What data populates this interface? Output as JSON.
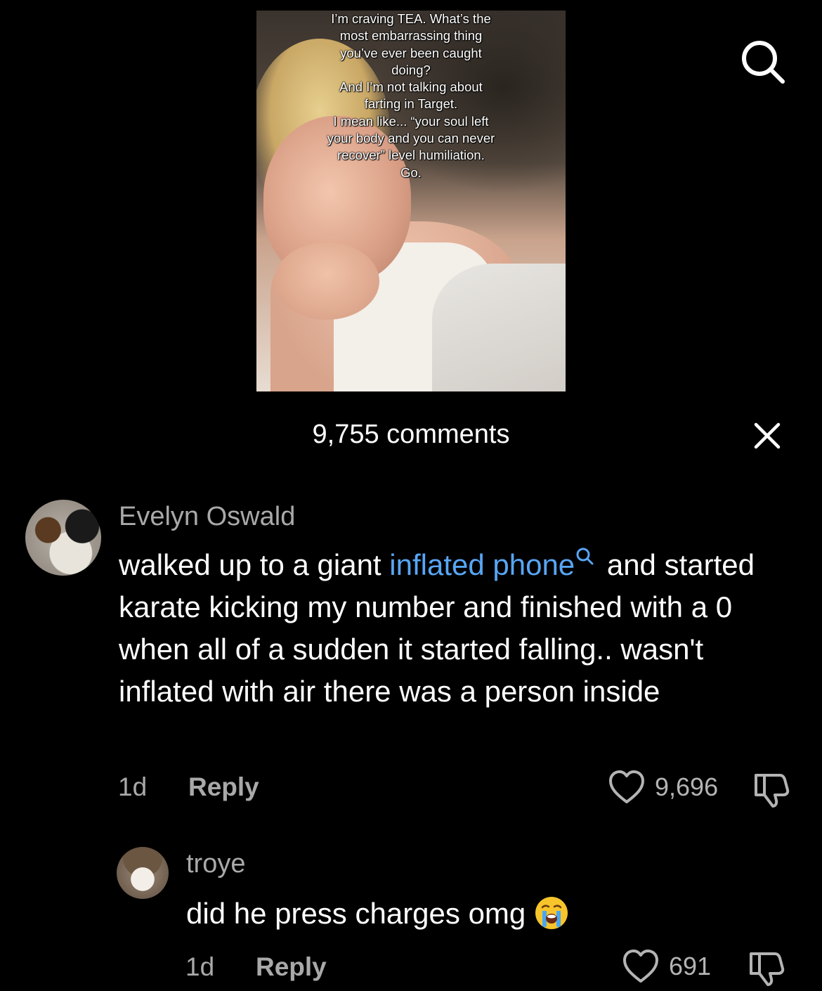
{
  "video": {
    "caption": "I’m craving TEA. What’s the\nmost embarrassing thing\nyou’ve ever been caught\ndoing?\nAnd I’m not talking about\nfarting in Target.\nI mean like... “your soul left\nyour body and you can never\nrecover” level humiliation.\nGo."
  },
  "header": {
    "comments_count": "9,755 comments"
  },
  "icons": {
    "search": "search-icon",
    "close": "close-icon",
    "heart": "heart-icon",
    "dislike": "thumbs-down-icon",
    "emoji": "loudly-crying-face"
  },
  "colors": {
    "background": "#000000",
    "link": "#58a6f5",
    "secondary_text": "#a9a9a9"
  },
  "comments": [
    {
      "username": "Evelyn Oswald",
      "text_before": "walked up to a giant ",
      "link_text": "inflated phone",
      "text_after": " and started karate kicking my number and finished with a 0 when all of a sudden it started falling.. wasn't inflated with air there was a person inside",
      "time": "1d",
      "reply_label": "Reply",
      "likes": "9,696"
    },
    {
      "username": "troye",
      "text": "did he press charges omg",
      "time": "1d",
      "reply_label": "Reply",
      "likes": "691"
    }
  ]
}
